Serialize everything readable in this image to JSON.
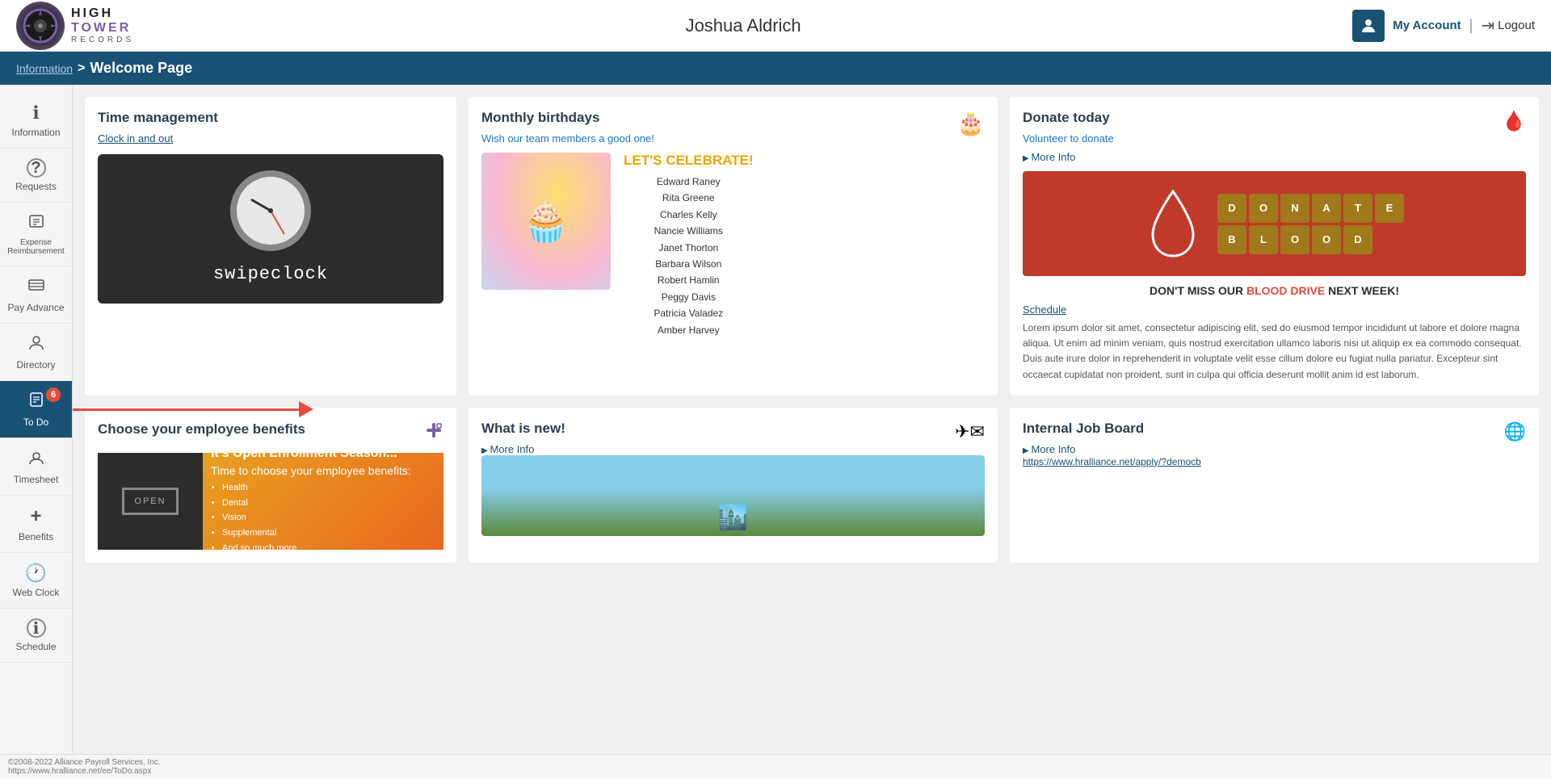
{
  "header": {
    "logo_line1": "HIGH",
    "logo_line2": "TOWER",
    "logo_line3": "RECORDS",
    "title": "Joshua Aldrich",
    "my_account": "My Account",
    "logout": "Logout"
  },
  "breadcrumb": {
    "link": "Information",
    "separator": ">",
    "current": "Welcome Page"
  },
  "sidebar": {
    "items": [
      {
        "label": "Information",
        "icon": "ℹ",
        "active": false
      },
      {
        "label": "Requests",
        "icon": "?",
        "active": false
      },
      {
        "label": "Expense Reimbursement",
        "icon": "💲",
        "active": false
      },
      {
        "label": "Pay Advance",
        "icon": "≡",
        "active": false
      },
      {
        "label": "Directory",
        "icon": "👤",
        "active": false
      },
      {
        "label": "To Do",
        "icon": "✓",
        "active": true,
        "badge": "6"
      },
      {
        "label": "Timesheet",
        "icon": "👤",
        "active": false
      },
      {
        "label": "Benefits",
        "icon": "+",
        "active": false
      },
      {
        "label": "Web Clock",
        "icon": "🕐",
        "active": false
      },
      {
        "label": "Schedule",
        "icon": "ℹ",
        "active": false
      }
    ]
  },
  "time_management": {
    "title": "Time management",
    "clock_in_out": "Clock in and out",
    "swipe_logo": "swipeclock"
  },
  "monthly_birthdays": {
    "title": "Monthly birthdays",
    "subtitle": "Wish our team members a good one!",
    "celebrate_prefix": "LET'S",
    "celebrate_highlight": "CELEBRATE!",
    "names": [
      "Edward Raney",
      "Rita Greene",
      "Charles Kelly",
      "Nancie Williams",
      "Janet Thorton",
      "Barbara Wilson",
      "Robert Hamlin",
      "Peggy Davis",
      "Patricia Valadez",
      "Amber Harvey"
    ]
  },
  "donate": {
    "title": "Donate today",
    "subtitle": "Volunteer to donate",
    "more_info": "More Info",
    "donate_tiles": [
      "D",
      "O",
      "N",
      "A",
      "T",
      "E",
      "B",
      "L",
      "O",
      "O",
      "D",
      ""
    ],
    "donate_word1": "DONATE",
    "donate_word2": "BLOOD",
    "cta_prefix": "DON'T MISS OUR",
    "cta_highlight": "BLOOD DRIVE",
    "cta_suffix": "NEXT WEEK!",
    "schedule": "Schedule",
    "lorem": "Lorem ipsum dolor sit amet, consectetur adipiscing elit, sed do eiusmod tempor incididunt ut labore et dolore magna aliqua. Ut enim ad minim veniam, quis nostrud exercitation ullamco laboris nisi ut aliquip ex ea commodo consequat. Duis aute irure dolor in reprehenderit in voluptate velit esse cillum dolore eu fugiat nulla pariatur. Excepteur sint occaecat cupidatat non proident, sunt in culpa qui officia deserunt mollit anim id est laborum."
  },
  "benefits": {
    "title": "Choose your employee benefits",
    "season_title": "It's Open Enrollment Season...",
    "time_text": "Time to choose your employee benefits:",
    "list": [
      "Health",
      "Dental",
      "Vision",
      "Supplemental",
      "And so much more"
    ]
  },
  "whats_new": {
    "title": "What is new!",
    "more_info": "More Info"
  },
  "job_board": {
    "title": "Internal Job Board",
    "more_info": "More Info",
    "link": "https://www.hralliance.net/apply/?democb"
  },
  "footer": {
    "copyright": "©2008-2022 Alliance Payroll Services, Inc.",
    "status_url": "https://www.hralliance.net/ee/ToDo.aspx"
  }
}
